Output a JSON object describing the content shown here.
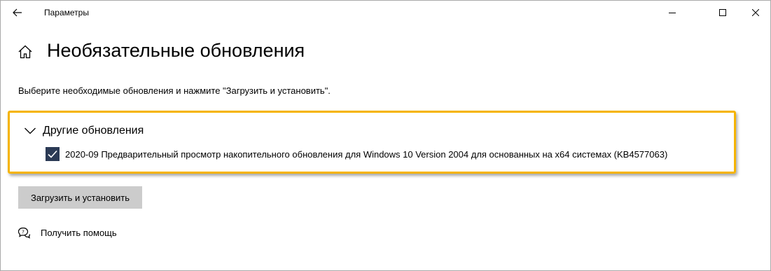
{
  "window": {
    "app_title": "Параметры"
  },
  "header": {
    "page_title": "Необязательные обновления",
    "instruction": "Выберите необходимые обновления и нажмите \"Загрузить и установить\"."
  },
  "updates_group": {
    "title": "Другие обновления",
    "expanded": true,
    "items": [
      {
        "label": "2020-09 Предварительный просмотр накопительного обновления для Windows 10 Version 2004 для основанных на x64 системах (KB4577063)",
        "checked": true
      }
    ]
  },
  "actions": {
    "install_label": "Загрузить и установить"
  },
  "help": {
    "label": "Получить помощь"
  },
  "icons": {
    "back": "back-arrow-icon",
    "home": "home-icon",
    "minimize": "minimize-icon",
    "maximize": "maximize-icon",
    "close": "close-icon",
    "chevron": "chevron-down-icon",
    "checkmark": "checkmark-icon",
    "help": "help-chat-icon"
  },
  "colors": {
    "highlight_frame": "#f5b400",
    "checkbox_fill": "#2b3a55",
    "button_bg": "#cccccc"
  }
}
